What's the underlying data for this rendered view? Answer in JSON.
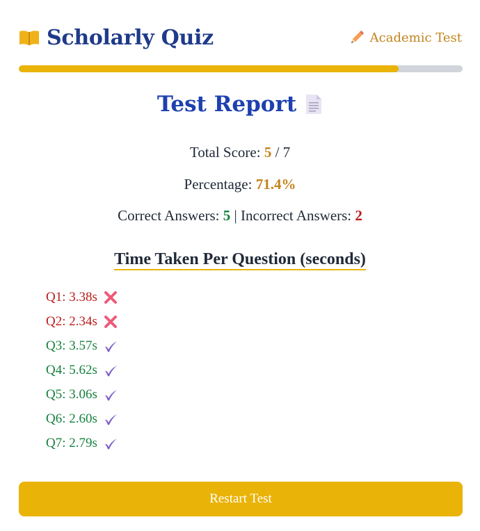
{
  "header": {
    "title": "Scholarly Quiz",
    "tag": "Academic Test",
    "icons": {
      "brand": "open-book-icon",
      "tag": "pencil-icon"
    }
  },
  "progress": {
    "fraction": 0.856
  },
  "report": {
    "title": "Test Report",
    "title_icon": "document-icon",
    "total_label": "Total Score:",
    "score": "5",
    "score_sep": "/ 7",
    "percentage_label": "Percentage:",
    "percentage": "71.4%",
    "correct_label": "Correct Answers:",
    "correct": "5",
    "divider": "|",
    "incorrect_label": "Incorrect Answers:",
    "incorrect": "2"
  },
  "times": {
    "title": "Time Taken Per Question (seconds)",
    "items": [
      {
        "label": "Q1: 3.38s",
        "correct": false
      },
      {
        "label": "Q2: 2.34s",
        "correct": false
      },
      {
        "label": "Q3: 3.57s",
        "correct": true
      },
      {
        "label": "Q4: 5.62s",
        "correct": true
      },
      {
        "label": "Q5: 3.06s",
        "correct": true
      },
      {
        "label": "Q6: 2.60s",
        "correct": true
      },
      {
        "label": "Q7: 2.79s",
        "correct": true
      }
    ]
  },
  "restart_label": "Restart Test",
  "colors": {
    "accent": "#eab308",
    "brand": "#1e3a8a",
    "correct": "#15803d",
    "incorrect": "#b91c1c"
  }
}
